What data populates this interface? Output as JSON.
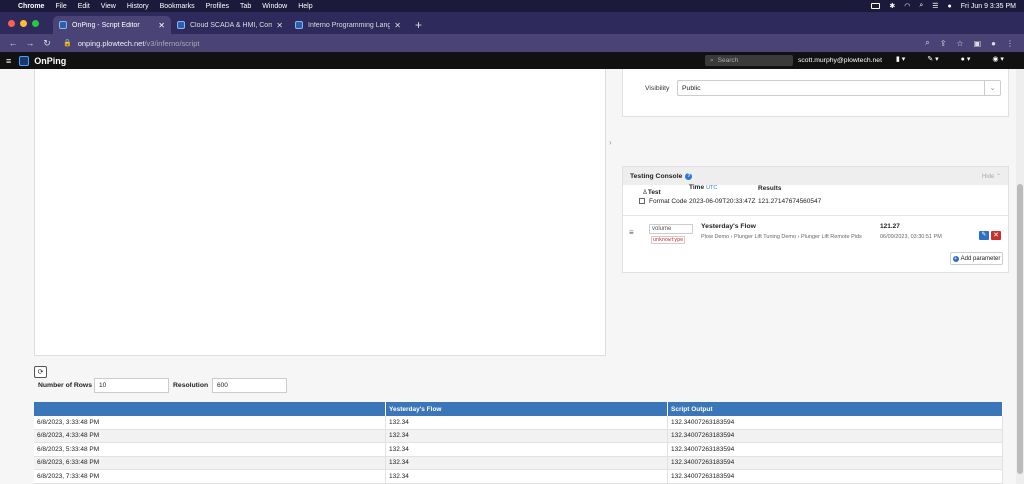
{
  "menubar": {
    "app": "Chrome",
    "items": [
      "File",
      "Edit",
      "View",
      "History",
      "Bookmarks",
      "Profiles",
      "Tab",
      "Window",
      "Help"
    ],
    "datetime": "Fri Jun 9  3:35 PM"
  },
  "tabs": [
    {
      "title": "OnPing - Script Editor",
      "active": true
    },
    {
      "title": "Cloud SCADA & HMI, Complete",
      "active": false
    },
    {
      "title": "Inferno Programming Language",
      "active": false
    }
  ],
  "address": {
    "host": "onping.plowtech.net",
    "path": "/v3/inferno/script"
  },
  "app": {
    "brand": "OnPing",
    "search_placeholder": "Search",
    "user": "scott.murphy@plowtech.net"
  },
  "visibility": {
    "label": "Visibility",
    "value": "Public"
  },
  "console": {
    "title": "Testing Console",
    "hide": "Hide",
    "col_test": "Test",
    "col_time": "Time",
    "col_time_unit": "UTC",
    "col_results": "Results",
    "format_code": "Format Code",
    "time_value": "2023-06-09T20:33:47Z",
    "result_value": "121.27147674560547",
    "param": {
      "input": "volume",
      "type": "unknowtype",
      "name": "Yesterday's Flow",
      "path": "Plow Demo  ›  Plunger Lift Tuning Demo  ›  Plunger Lift Remote Pids",
      "value": "121.27",
      "time": "06/09/2023, 03:30:51 PM"
    },
    "add_param": "Add parameter"
  },
  "controls": {
    "rows_label": "Number of Rows",
    "rows_value": "10",
    "resolution_label": "Resolution",
    "resolution_value": "600"
  },
  "table": {
    "headers": [
      "",
      "Yesterday's Flow",
      "Script Output"
    ],
    "rows": [
      [
        "6/8/2023, 3:33:48 PM",
        "132.34",
        "132.34007263183594"
      ],
      [
        "6/8/2023, 4:33:48 PM",
        "132.34",
        "132.34007263183594"
      ],
      [
        "6/8/2023, 5:33:48 PM",
        "132.34",
        "132.34007263183594"
      ],
      [
        "6/8/2023, 6:33:48 PM",
        "132.34",
        "132.34007263183594"
      ],
      [
        "6/8/2023, 7:33:48 PM",
        "132.34",
        "132.34007263183594"
      ]
    ]
  }
}
